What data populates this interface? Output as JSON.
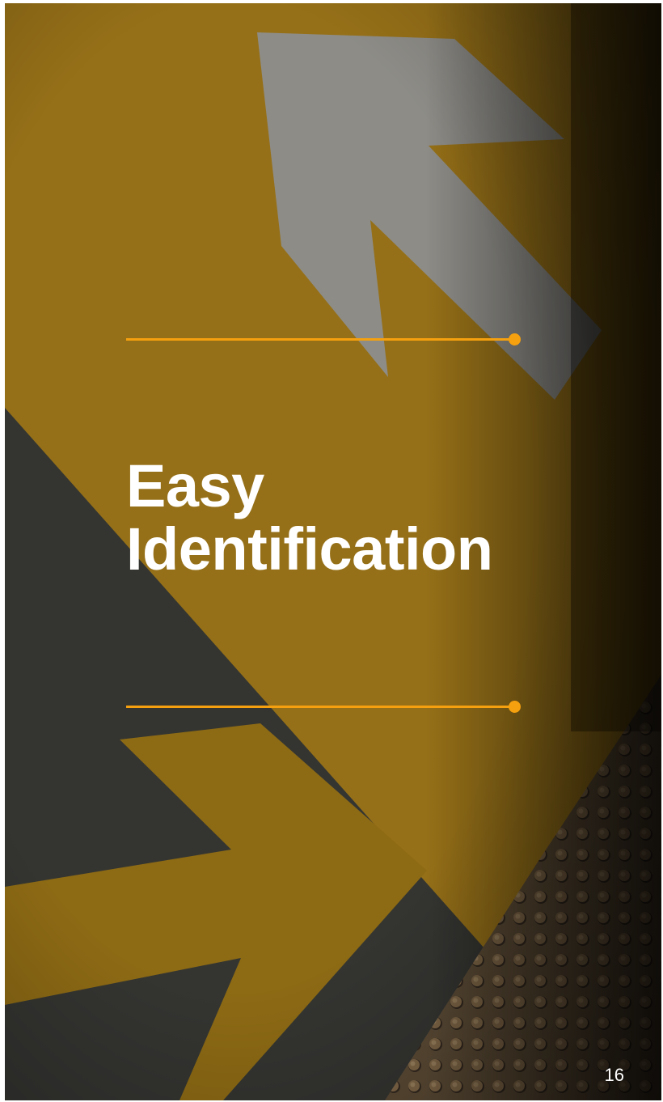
{
  "slide": {
    "title_lines": [
      "Easy",
      "Identification"
    ],
    "page_number": "16"
  },
  "colors": {
    "accent": "#f5a00e",
    "text": "#ffffff",
    "pavement_yellow": "#b8891c",
    "asphalt": "#3e3f3a",
    "arrow_white": "#a8a6a0",
    "tactile_tile": "#8b7050"
  },
  "background": {
    "description_icon": "road-arrows-photo"
  }
}
